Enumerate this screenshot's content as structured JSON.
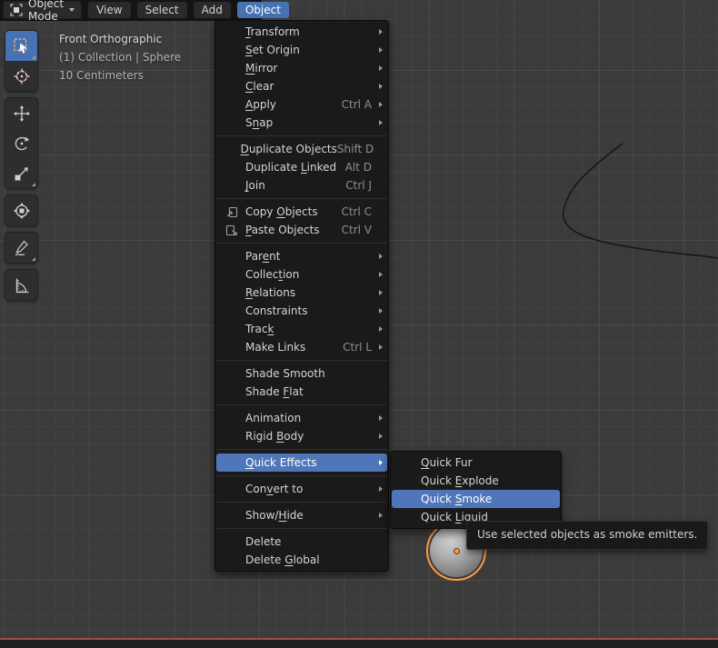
{
  "header": {
    "mode_selector": {
      "label": "Object Mode"
    },
    "menus": [
      {
        "label": "View"
      },
      {
        "label": "Select"
      },
      {
        "label": "Add"
      },
      {
        "label": "Object",
        "active": true
      }
    ]
  },
  "viewport_overlay": {
    "view_name": "Front Orthographic",
    "collection_info": "(1) Collection | Sphere",
    "scale_info": "10 Centimeters"
  },
  "toolbar": {
    "tools": [
      "select-box",
      "cursor",
      "move",
      "rotate",
      "scale",
      "transform",
      "annotate",
      "measure"
    ],
    "active_tool": "select-box"
  },
  "object_menu": {
    "items": [
      {
        "pre": "",
        "accel": "T",
        "post": "ransform",
        "shortcut": "",
        "submenu": true
      },
      {
        "pre": "",
        "accel": "S",
        "post": "et Origin",
        "shortcut": "",
        "submenu": true
      },
      {
        "pre": "",
        "accel": "M",
        "post": "irror",
        "shortcut": "",
        "submenu": true
      },
      {
        "pre": "",
        "accel": "C",
        "post": "lear",
        "shortcut": "",
        "submenu": true
      },
      {
        "pre": "",
        "accel": "A",
        "post": "pply",
        "shortcut": "Ctrl A",
        "submenu": true
      },
      {
        "pre": "S",
        "accel": "n",
        "post": "ap",
        "shortcut": "",
        "submenu": true
      },
      {
        "pre": "",
        "accel": "D",
        "post": "uplicate Objects",
        "shortcut": "Shift D"
      },
      {
        "pre": "Duplicate ",
        "accel": "L",
        "post": "inked",
        "shortcut": "Alt D"
      },
      {
        "pre": "",
        "accel": "J",
        "post": "oin",
        "shortcut": "Ctrl J"
      },
      {
        "pre": "Copy ",
        "accel": "O",
        "post": "bjects",
        "shortcut": "Ctrl C",
        "icon": "copy-icon"
      },
      {
        "pre": "",
        "accel": "P",
        "post": "aste Objects",
        "shortcut": "Ctrl V",
        "icon": "paste-icon"
      },
      {
        "pre": "Par",
        "accel": "e",
        "post": "nt",
        "shortcut": "",
        "submenu": true
      },
      {
        "pre": "Collec",
        "accel": "t",
        "post": "ion",
        "shortcut": "",
        "submenu": true
      },
      {
        "pre": "",
        "accel": "R",
        "post": "elations",
        "shortcut": "",
        "submenu": true
      },
      {
        "pre": "Constraints",
        "accel": "",
        "post": "",
        "shortcut": "",
        "submenu": true
      },
      {
        "pre": "Trac",
        "accel": "k",
        "post": "",
        "shortcut": "",
        "submenu": true
      },
      {
        "pre": "Make Links",
        "accel": "",
        "post": "",
        "shortcut": "Ctrl L",
        "submenu": true
      },
      {
        "pre": "Shade Smooth",
        "accel": "",
        "post": "",
        "shortcut": ""
      },
      {
        "pre": "Shade ",
        "accel": "F",
        "post": "lat",
        "shortcut": ""
      },
      {
        "pre": "Animation",
        "accel": "",
        "post": "",
        "shortcut": "",
        "submenu": true
      },
      {
        "pre": "Rigid ",
        "accel": "B",
        "post": "ody",
        "shortcut": "",
        "submenu": true
      },
      {
        "pre": "",
        "accel": "Q",
        "post": "uick Effects",
        "shortcut": "",
        "submenu": true,
        "highlighted": true
      },
      {
        "pre": "Con",
        "accel": "v",
        "post": "ert to",
        "shortcut": "",
        "submenu": true
      },
      {
        "pre": "Show/",
        "accel": "H",
        "post": "ide",
        "shortcut": "",
        "submenu": true
      },
      {
        "pre": "Delete",
        "accel": "",
        "post": "",
        "shortcut": ""
      },
      {
        "pre": "Delete ",
        "accel": "G",
        "post": "lobal",
        "shortcut": ""
      }
    ]
  },
  "quick_effects_submenu": {
    "items": [
      {
        "pre": "",
        "accel": "Q",
        "post": "uick Fur"
      },
      {
        "pre": "Quick ",
        "accel": "E",
        "post": "xplode"
      },
      {
        "pre": "Quick ",
        "accel": "S",
        "post": "moke",
        "highlighted": true
      },
      {
        "pre": "Quick ",
        "accel": "L",
        "post": "iquid"
      }
    ]
  },
  "tooltip": {
    "text": "Use selected objects as smoke emitters."
  },
  "scene": {
    "selected_object": "Sphere"
  },
  "colors": {
    "accent_blue": "#4772b3",
    "highlight_blue": "#4f76b8",
    "selection_outline_orange": "#ff9a3c",
    "axis_x_red": "#9e4b50",
    "viewport_bg": "#3b3b3b",
    "menu_bg": "#1a1a1a"
  }
}
